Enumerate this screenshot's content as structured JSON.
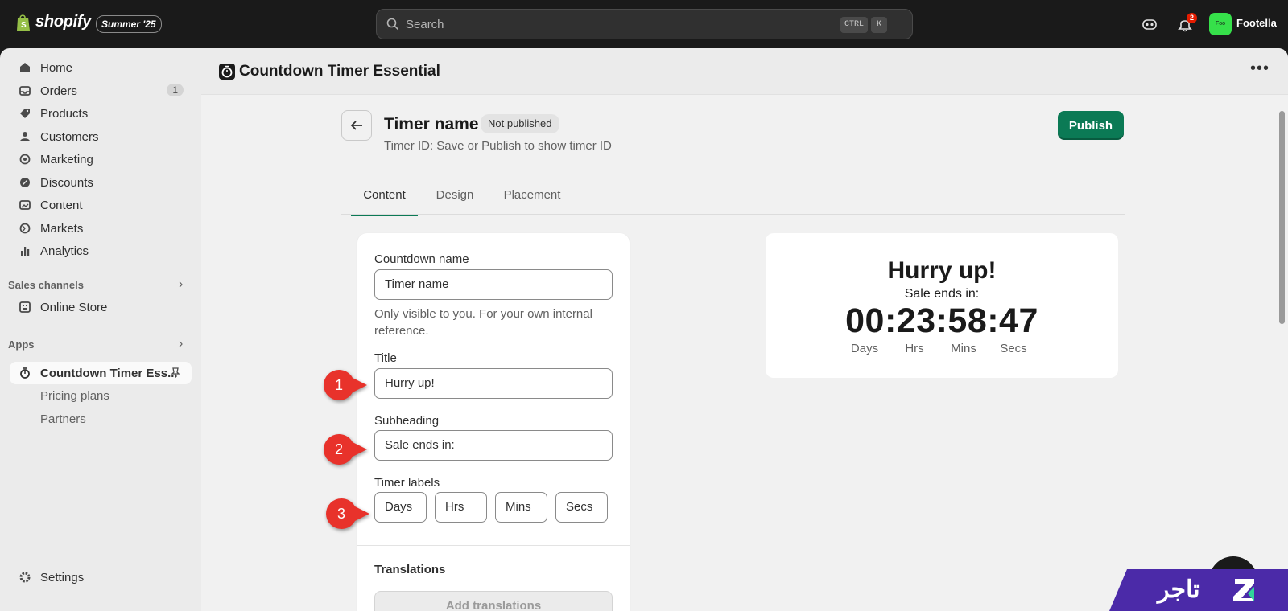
{
  "topbar": {
    "brand": "shopify",
    "badge": "Summer '25",
    "search_placeholder": "Search",
    "kbd_ctrl": "CTRL",
    "kbd_k": "K",
    "notification_count": "2",
    "store_avatar": "Foo",
    "store_name": "Footella"
  },
  "sidebar": {
    "items": [
      {
        "label": "Home",
        "icon": "home-icon"
      },
      {
        "label": "Orders",
        "icon": "inbox-icon",
        "count": "1"
      },
      {
        "label": "Products",
        "icon": "tag-icon"
      },
      {
        "label": "Customers",
        "icon": "person-icon"
      },
      {
        "label": "Marketing",
        "icon": "target-icon"
      },
      {
        "label": "Discounts",
        "icon": "discount-icon"
      },
      {
        "label": "Content",
        "icon": "image-icon"
      },
      {
        "label": "Markets",
        "icon": "globe-icon"
      },
      {
        "label": "Analytics",
        "icon": "bar-chart-icon"
      }
    ],
    "sales_channels_heading": "Sales channels",
    "online_store": "Online Store",
    "apps_heading": "Apps",
    "active_app": "Countdown Timer Ess...",
    "app_sub_items": [
      "Pricing plans",
      "Partners"
    ],
    "settings": "Settings"
  },
  "app": {
    "title": "Countdown Timer Essential"
  },
  "page": {
    "timer_name": "Timer name",
    "status": "Not published",
    "timer_id": "Timer ID: Save or Publish to show timer ID",
    "publish": "Publish",
    "tabs": [
      "Content",
      "Design",
      "Placement"
    ]
  },
  "form": {
    "countdown_name_label": "Countdown name",
    "countdown_name_value": "Timer name",
    "hint": "Only visible to you. For your own internal reference.",
    "title_label": "Title",
    "title_value": "Hurry up!",
    "subheading_label": "Subheading",
    "subheading_value": "Sale ends in:",
    "timer_labels_label": "Timer labels",
    "timer_labels": [
      "Days",
      "Hrs",
      "Mins",
      "Secs"
    ],
    "translations_heading": "Translations",
    "add_translations": "Add translations"
  },
  "preview": {
    "title": "Hurry up!",
    "subheading": "Sale ends in:",
    "time": "00:23:58:47",
    "labels": [
      "Days",
      "Hrs",
      "Mins",
      "Secs"
    ]
  },
  "callouts": [
    "1",
    "2",
    "3"
  ],
  "watermark": "تاجر"
}
